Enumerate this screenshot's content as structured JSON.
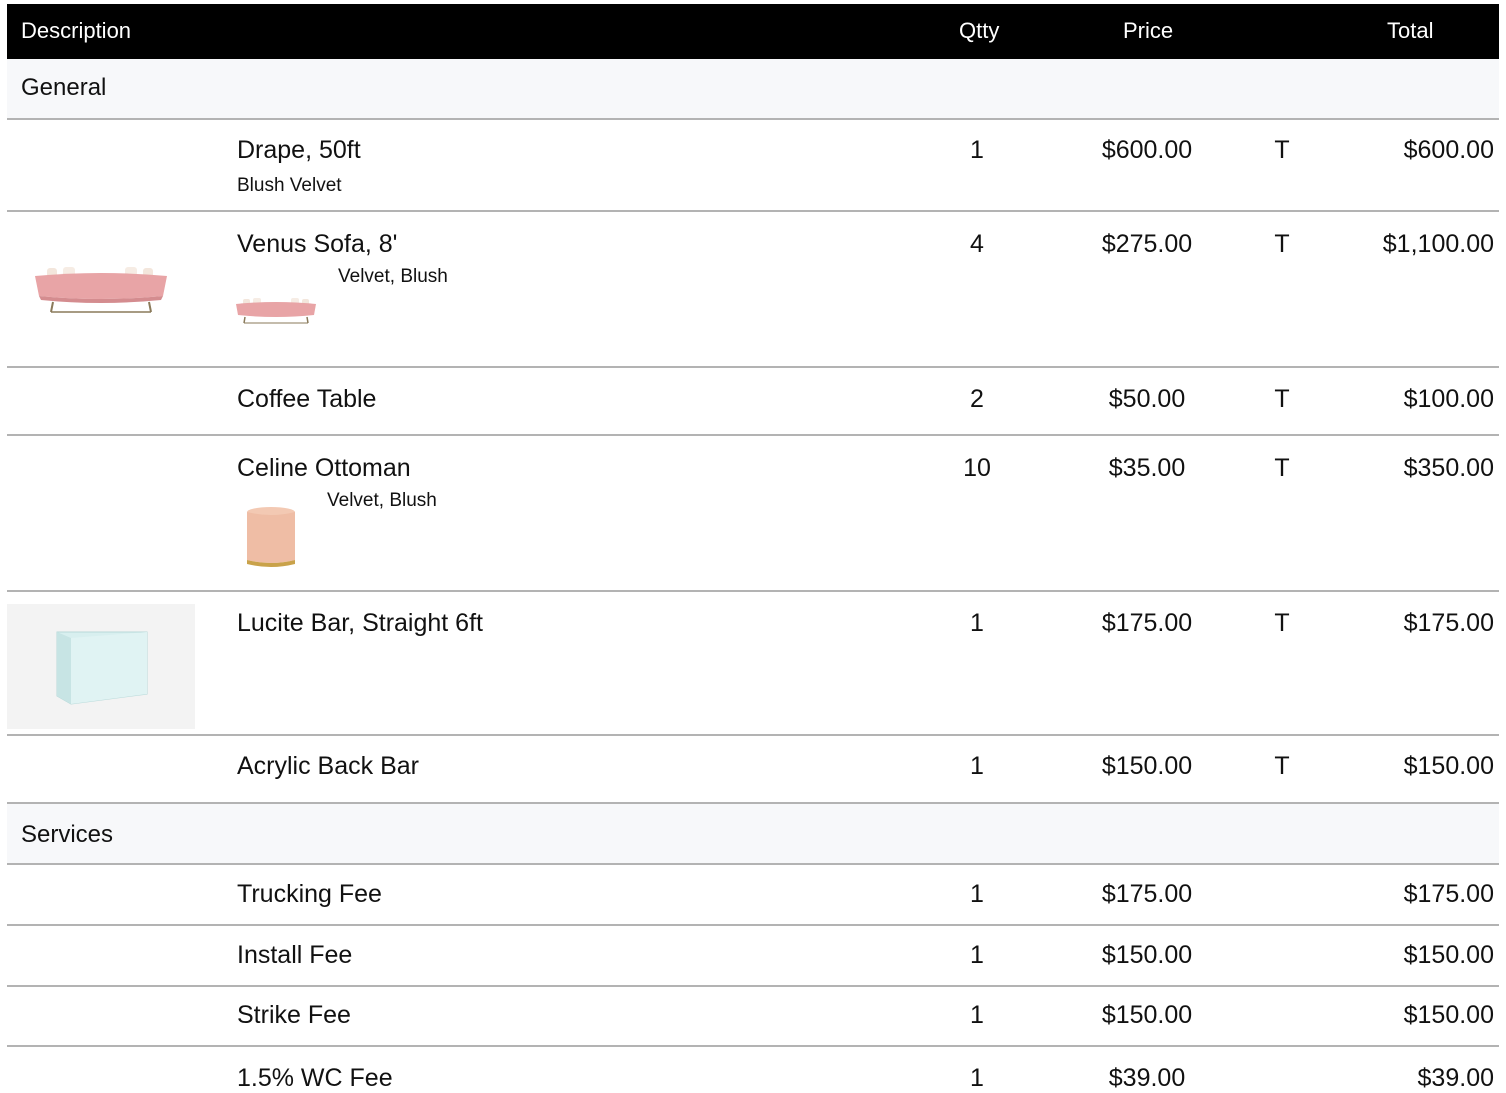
{
  "header": {
    "description": "Description",
    "qty": "Qtty",
    "price": "Price",
    "total": "Total"
  },
  "sections": {
    "general": "General",
    "services": "Services"
  },
  "items": [
    {
      "name": "Drape, 50ft",
      "sub": "Blush Velvet",
      "qty": "1",
      "price": "$600.00",
      "tax": "T",
      "total": "$600.00"
    },
    {
      "name": "Venus Sofa, 8'",
      "sub": "Velvet, Blush",
      "qty": "4",
      "price": "$275.00",
      "tax": "T",
      "total": "$1,100.00"
    },
    {
      "name": "Coffee Table",
      "qty": "2",
      "price": "$50.00",
      "tax": "T",
      "total": "$100.00"
    },
    {
      "name": "Celine Ottoman",
      "sub": "Velvet, Blush",
      "qty": "10",
      "price": "$35.00",
      "tax": "T",
      "total": "$350.00"
    },
    {
      "name": "Lucite Bar, Straight 6ft",
      "qty": "1",
      "price": "$175.00",
      "tax": "T",
      "total": "$175.00"
    },
    {
      "name": "Acrylic Back Bar",
      "qty": "1",
      "price": "$150.00",
      "tax": "T",
      "total": "$150.00"
    },
    {
      "name": "Trucking Fee",
      "qty": "1",
      "price": "$175.00",
      "total": "$175.00"
    },
    {
      "name": "Install Fee",
      "qty": "1",
      "price": "$150.00",
      "total": "$150.00"
    },
    {
      "name": "Strike Fee",
      "qty": "1",
      "price": "$150.00",
      "total": "$150.00"
    },
    {
      "name": "1.5% WC Fee",
      "qty": "1",
      "price": "$39.00",
      "total": "$39.00"
    }
  ],
  "colors": {
    "header_bg": "#000000",
    "section_bg": "#f7f8fa",
    "divider": "#b3b3b3",
    "sofa_pink": "#e8a4a6",
    "ottoman_peach": "#efbda5",
    "lucite_blue": "#d8efef"
  }
}
